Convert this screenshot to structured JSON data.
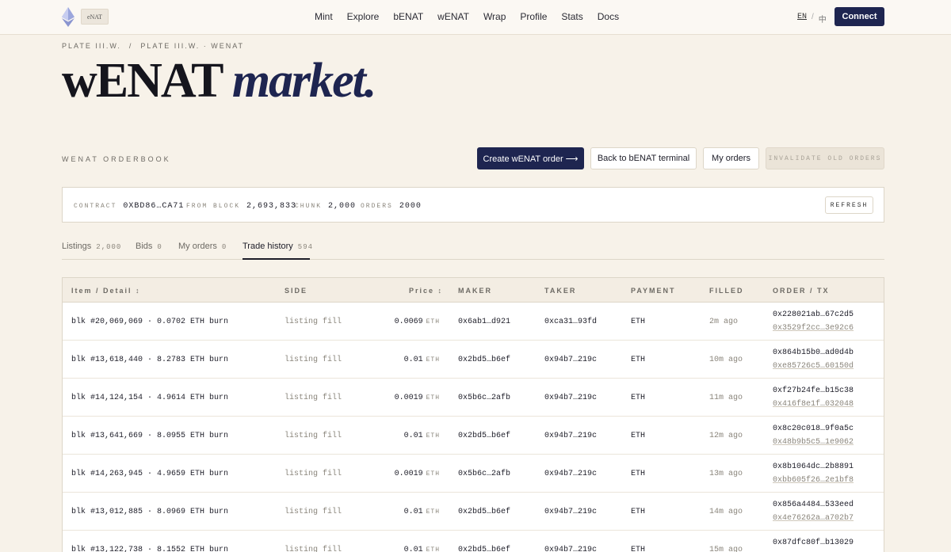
{
  "brand": {
    "tag": "eNAT"
  },
  "nav": [
    "Mint",
    "Explore",
    "bENAT",
    "wENAT",
    "Wrap",
    "Profile",
    "Stats",
    "Docs"
  ],
  "lang": {
    "en": "EN",
    "sep": "/",
    "zh": "中"
  },
  "connect_label": "Connect",
  "breadcrumb": {
    "first": "PLATE III.W.",
    "sep": "/",
    "second": "PLATE III.W. · WENAT"
  },
  "title": {
    "plain": "wENAT",
    "italic": "market."
  },
  "orderbook_label": "WENAT ORDERBOOK",
  "buttons": {
    "create": "Create wENAT order ⟶",
    "back": "Back to bENAT terminal",
    "my_orders": "My orders",
    "invalidate": "INVALIDATE OLD ORDERS"
  },
  "contract": {
    "contract_key": "CONTRACT",
    "contract_val": "0XBD86…CA71",
    "block_key": "FROM BLOCK",
    "block_val": "2,693,833",
    "chunk_key": "CHUNK",
    "chunk_val": "2,000",
    "orders_key": "ORDERS",
    "orders_val": "2000",
    "refresh": "REFRESH"
  },
  "tabs": [
    {
      "label": "Listings",
      "count": "2,000"
    },
    {
      "label": "Bids",
      "count": "0"
    },
    {
      "label": "My orders",
      "count": "0"
    },
    {
      "label": "Trade history",
      "count": "594"
    }
  ],
  "columns": {
    "item": "Item / Detail ↕",
    "side": "SIDE",
    "price": "Price ↕",
    "maker": "MAKER",
    "taker": "TAKER",
    "payment": "PAYMENT",
    "filled": "FILLED",
    "order": "ORDER / TX"
  },
  "rows": [
    {
      "item": "blk #20,069,069 · 0.0702 ETH burn",
      "side": "listing fill",
      "price": "0.0069",
      "unit": "ETH",
      "maker": "0x6ab1…d921",
      "taker": "0xca31…93fd",
      "payment": "ETH",
      "filled": "2m ago",
      "order": "0x228021ab…67c2d5",
      "tx": "0x3529f2cc…3e92c6"
    },
    {
      "item": "blk #13,618,440 · 8.2783 ETH burn",
      "side": "listing fill",
      "price": "0.01",
      "unit": "ETH",
      "maker": "0x2bd5…b6ef",
      "taker": "0x94b7…219c",
      "payment": "ETH",
      "filled": "10m ago",
      "order": "0x864b15b0…ad0d4b",
      "tx": "0xe85726c5…60150d"
    },
    {
      "item": "blk #14,124,154 · 4.9614 ETH burn",
      "side": "listing fill",
      "price": "0.0019",
      "unit": "ETH",
      "maker": "0x5b6c…2afb",
      "taker": "0x94b7…219c",
      "payment": "ETH",
      "filled": "11m ago",
      "order": "0xf27b24fe…b15c38",
      "tx": "0x416f8e1f…032048"
    },
    {
      "item": "blk #13,641,669 · 8.0955 ETH burn",
      "side": "listing fill",
      "price": "0.01",
      "unit": "ETH",
      "maker": "0x2bd5…b6ef",
      "taker": "0x94b7…219c",
      "payment": "ETH",
      "filled": "12m ago",
      "order": "0x8c20c018…9f0a5c",
      "tx": "0x48b9b5c5…1e9062"
    },
    {
      "item": "blk #14,263,945 · 4.9659 ETH burn",
      "side": "listing fill",
      "price": "0.0019",
      "unit": "ETH",
      "maker": "0x5b6c…2afb",
      "taker": "0x94b7…219c",
      "payment": "ETH",
      "filled": "13m ago",
      "order": "0x8b1064dc…2b8891",
      "tx": "0xbb605f26…2e1bf8"
    },
    {
      "item": "blk #13,012,885 · 8.0969 ETH burn",
      "side": "listing fill",
      "price": "0.01",
      "unit": "ETH",
      "maker": "0x2bd5…b6ef",
      "taker": "0x94b7…219c",
      "payment": "ETH",
      "filled": "14m ago",
      "order": "0x856a4484…533eed",
      "tx": "0x4e76262a…a702b7"
    },
    {
      "item": "blk #13,122,738 · 8.1552 ETH burn",
      "side": "listing fill",
      "price": "0.01",
      "unit": "ETH",
      "maker": "0x2bd5…b6ef",
      "taker": "0x94b7…219c",
      "payment": "ETH",
      "filled": "15m ago",
      "order": "0x87dfc80f…b13029",
      "tx": ""
    }
  ]
}
